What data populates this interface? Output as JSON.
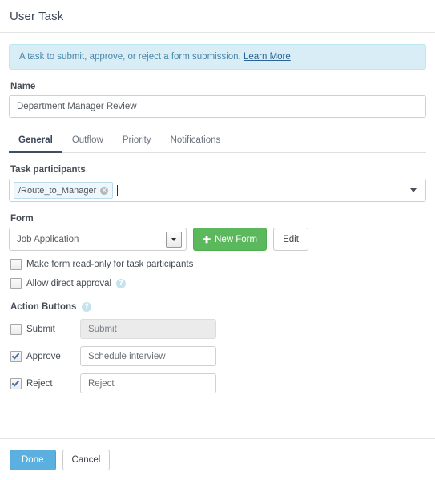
{
  "header": {
    "title": "User Task"
  },
  "banner": {
    "text": "A task to submit, approve, or reject a form submission.",
    "link_label": "Learn More",
    "bg_color": "#d9edf7",
    "border_color": "#bce8f1",
    "text_color": "#4a87a8"
  },
  "name_field": {
    "label": "Name",
    "value": "Department Manager Review"
  },
  "tabs": [
    {
      "label": "General",
      "active": true
    },
    {
      "label": "Outflow",
      "active": false
    },
    {
      "label": "Priority",
      "active": false
    },
    {
      "label": "Notifications",
      "active": false
    }
  ],
  "participants": {
    "label": "Task participants",
    "tokens": [
      {
        "label": "/Route_to_Manager",
        "remove_icon": "close-circle-icon"
      }
    ],
    "dropdown_icon": "chevron-down-icon"
  },
  "form_section": {
    "label": "Form",
    "selected_form": "Job Application",
    "select_icon": "chevron-down-icon",
    "new_form_label": "New Form",
    "new_form_icon": "plus-icon",
    "new_form_color": "#5cb85c",
    "edit_label": "Edit"
  },
  "options": [
    {
      "label": "Make form read-only for task participants",
      "checked": false,
      "help": false
    },
    {
      "label": "Allow direct approval",
      "checked": false,
      "help": true
    }
  ],
  "action_buttons": {
    "label": "Action Buttons",
    "help_icon": "question-circle-icon",
    "rows": [
      {
        "name": "Submit",
        "checked": false,
        "value": "Submit",
        "disabled": true
      },
      {
        "name": "Approve",
        "checked": true,
        "value": "Schedule interview",
        "disabled": false
      },
      {
        "name": "Reject",
        "checked": true,
        "value": "Reject",
        "disabled": false
      }
    ]
  },
  "footer": {
    "done_label": "Done",
    "cancel_label": "Cancel",
    "done_color": "#5bb0df"
  }
}
